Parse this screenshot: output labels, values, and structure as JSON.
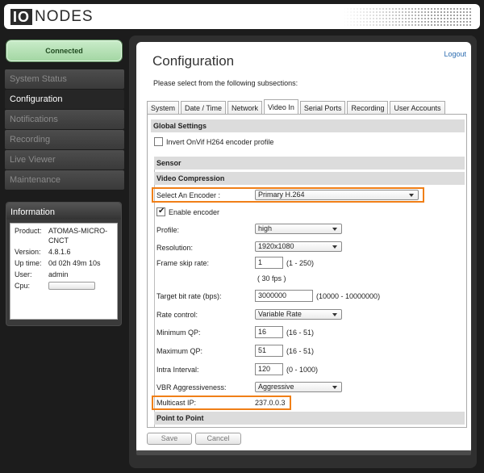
{
  "header": {
    "logo_io": "IO",
    "logo_nodes": "NODES"
  },
  "status": {
    "label": "Connected"
  },
  "nav": {
    "items": [
      "System Status",
      "Configuration",
      "Notifications",
      "Recording",
      "Live Viewer",
      "Maintenance"
    ],
    "active_index": 1
  },
  "info": {
    "title": "Information",
    "product_label": "Product:",
    "product_value": "ATOMAS-MICRO-CNCT",
    "version_label": "Version:",
    "version_value": "4.8.1.6",
    "uptime_label": "Up time:",
    "uptime_value": "0d 02h 49m 10s",
    "user_label": "User:",
    "user_value": "admin",
    "cpu_label": "Cpu:"
  },
  "page": {
    "logout": "Logout",
    "title": "Configuration",
    "subtitle": "Please select from the following subsections:"
  },
  "tabs": [
    "System",
    "Date / Time",
    "Network",
    "Video In",
    "Serial Ports",
    "Recording",
    "User Accounts"
  ],
  "active_tab": "Video In",
  "sections": {
    "global": "Global Settings",
    "invert_onvif": "Invert OnVif H264 encoder profile",
    "sensor": "Sensor",
    "video_compression": "Video Compression",
    "point_to_point": "Point to Point"
  },
  "form": {
    "encoder_label": "Select An Encoder :",
    "encoder_value": "Primary H.264",
    "enable_label": "Enable encoder",
    "enable_checked": true,
    "profile_label": "Profile:",
    "profile_value": "high",
    "resolution_label": "Resolution:",
    "resolution_value": "1920x1080",
    "frameskip_label": "Frame skip rate:",
    "frameskip_value": "1",
    "frameskip_range": "(1 - 250)",
    "fps_note": "( 30 fps )",
    "bitrate_label": "Target bit rate (bps):",
    "bitrate_value": "3000000",
    "bitrate_range": "(10000 - 10000000)",
    "ratecontrol_label": "Rate control:",
    "ratecontrol_value": "Variable Rate",
    "minqp_label": "Minimum QP:",
    "minqp_value": "16",
    "minqp_range": "(16 - 51)",
    "maxqp_label": "Maximum QP:",
    "maxqp_value": "51",
    "maxqp_range": "(16 - 51)",
    "intra_label": "Intra Interval:",
    "intra_value": "120",
    "intra_range": "(0 - 1000)",
    "vbr_label": "VBR Aggressiveness:",
    "vbr_value": "Aggressive",
    "multicast_label": "Multicast IP:",
    "multicast_value": "237.0.0.3"
  },
  "buttons": {
    "save": "Save",
    "cancel": "Cancel"
  },
  "colors": {
    "highlight": "#f07f17",
    "connected": "#a4d7a4",
    "link": "#2b6cb0"
  }
}
